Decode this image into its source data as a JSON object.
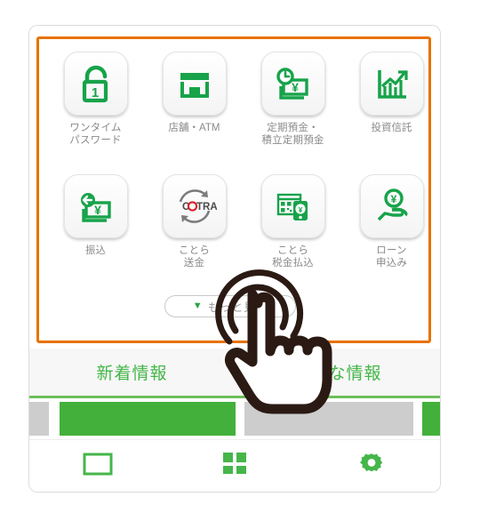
{
  "app": {
    "highlight_color": "#e87200",
    "brand_green": "#2aa544",
    "tab_green": "#45b649",
    "label_gray": "#8a8a8a"
  },
  "grid": {
    "tiles": [
      {
        "id": "one-time-password",
        "icon": "padlock-one-icon",
        "label": "ワンタイム\nパスワード"
      },
      {
        "id": "branch-atm",
        "icon": "storefront-icon",
        "label": "店舗・ATM"
      },
      {
        "id": "time-deposit",
        "icon": "clock-yen-note-icon",
        "label": "定期預金・\n積立定期預金"
      },
      {
        "id": "investment-trust",
        "icon": "bar-chart-arrow-icon",
        "label": "投資信託"
      },
      {
        "id": "transfer",
        "icon": "arrow-yen-note-icon",
        "label": "振込"
      },
      {
        "id": "cotra-remittance",
        "icon": "cotra-logo-icon",
        "label": "ことら\n送金"
      },
      {
        "id": "cotra-tax-payment",
        "icon": "qr-phone-yen-icon",
        "label": "ことら\n税金払込"
      },
      {
        "id": "loan-application",
        "icon": "hand-yen-coin-icon",
        "label": "ローン\n申込み"
      }
    ]
  },
  "more_button": {
    "label": "もっと見る",
    "chevron": "chevron-down-icon"
  },
  "tabs": [
    {
      "id": "news",
      "label": "新着情報"
    },
    {
      "id": "offers",
      "label": "お得な情報"
    }
  ],
  "banners": [
    {
      "kind": "grey",
      "width": 22
    },
    {
      "kind": "green",
      "width": 198
    },
    {
      "kind": "grey",
      "width": 198
    },
    {
      "kind": "green",
      "width": 22
    }
  ],
  "bottom_nav": [
    {
      "id": "home",
      "icon": "rectangle-outline-icon"
    },
    {
      "id": "menu",
      "icon": "grid-squares-icon"
    },
    {
      "id": "settings",
      "icon": "gear-icon"
    }
  ],
  "touch": {
    "gesture": "tap-hand-pointer",
    "ripple": "tap-ripple-arcs"
  }
}
